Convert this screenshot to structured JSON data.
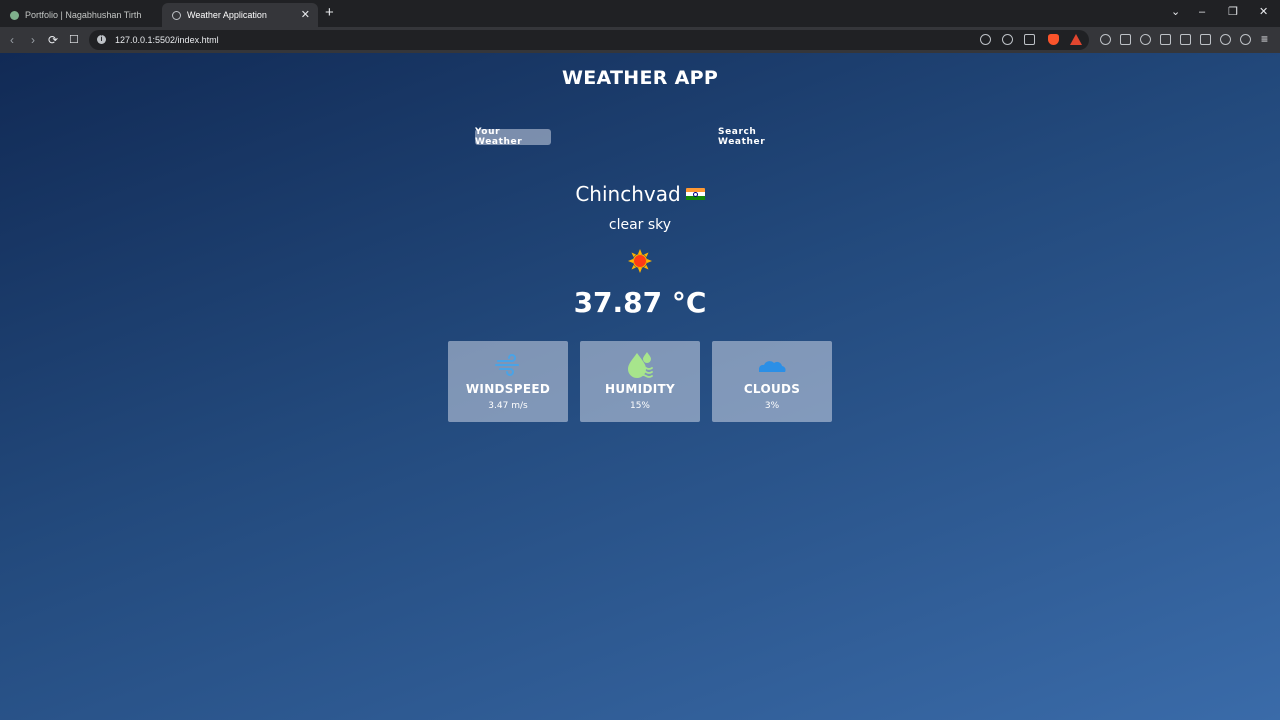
{
  "browser": {
    "tabs": [
      {
        "title": "Portfolio | Nagabhushan Tirth",
        "active": false
      },
      {
        "title": "Weather Application",
        "active": true
      }
    ],
    "new_tab_label": "+",
    "url": "127.0.0.1:5502/index.html",
    "tab_close_glyph": "✕",
    "window_controls": [
      "⌄",
      "–",
      "❐",
      "✕"
    ],
    "nav_glyphs": {
      "back": "‹",
      "forward": "›",
      "reload": "⟳",
      "bookmark": "🔖"
    },
    "menu_glyph": "≡",
    "info_glyph": "i",
    "toolbar_icons": [
      "location-icon",
      "zoom-icon",
      "share-icon",
      "brave-shields-icon",
      "brave-rewards-icon",
      "extension-icon",
      "extension-icon",
      "react-devtools-icon",
      "puzzle-icon",
      "sidebar-icon",
      "wallet-icon",
      "leo-icon",
      "vpn-icon",
      "menu-icon"
    ]
  },
  "app": {
    "title": "WEATHER APP",
    "tabs": {
      "your_weather": "Your Weather",
      "search_weather": "Search Weather"
    },
    "city": "Chinchvad",
    "country_flag": "india-flag-icon",
    "description": "clear sky",
    "weather_icon": "sun-icon",
    "temperature": "37.87 °C",
    "cards": [
      {
        "title": "WINDSPEED",
        "value": "3.47 m/s",
        "icon": "wind-icon"
      },
      {
        "title": "HUMIDITY",
        "value": "15%",
        "icon": "humidity-icon"
      },
      {
        "title": "CLOUDS",
        "value": "3%",
        "icon": "cloud-icon"
      }
    ]
  },
  "colors": {
    "background_top": "#112a55",
    "background_bottom": "#3a6ba9",
    "card_background": "#8a9fbd",
    "wind_icon": "#4aa3e6",
    "humidity_icon": "#a7e58c",
    "cloud_icon": "#2b8fe6",
    "sun": "#ff3b14"
  }
}
